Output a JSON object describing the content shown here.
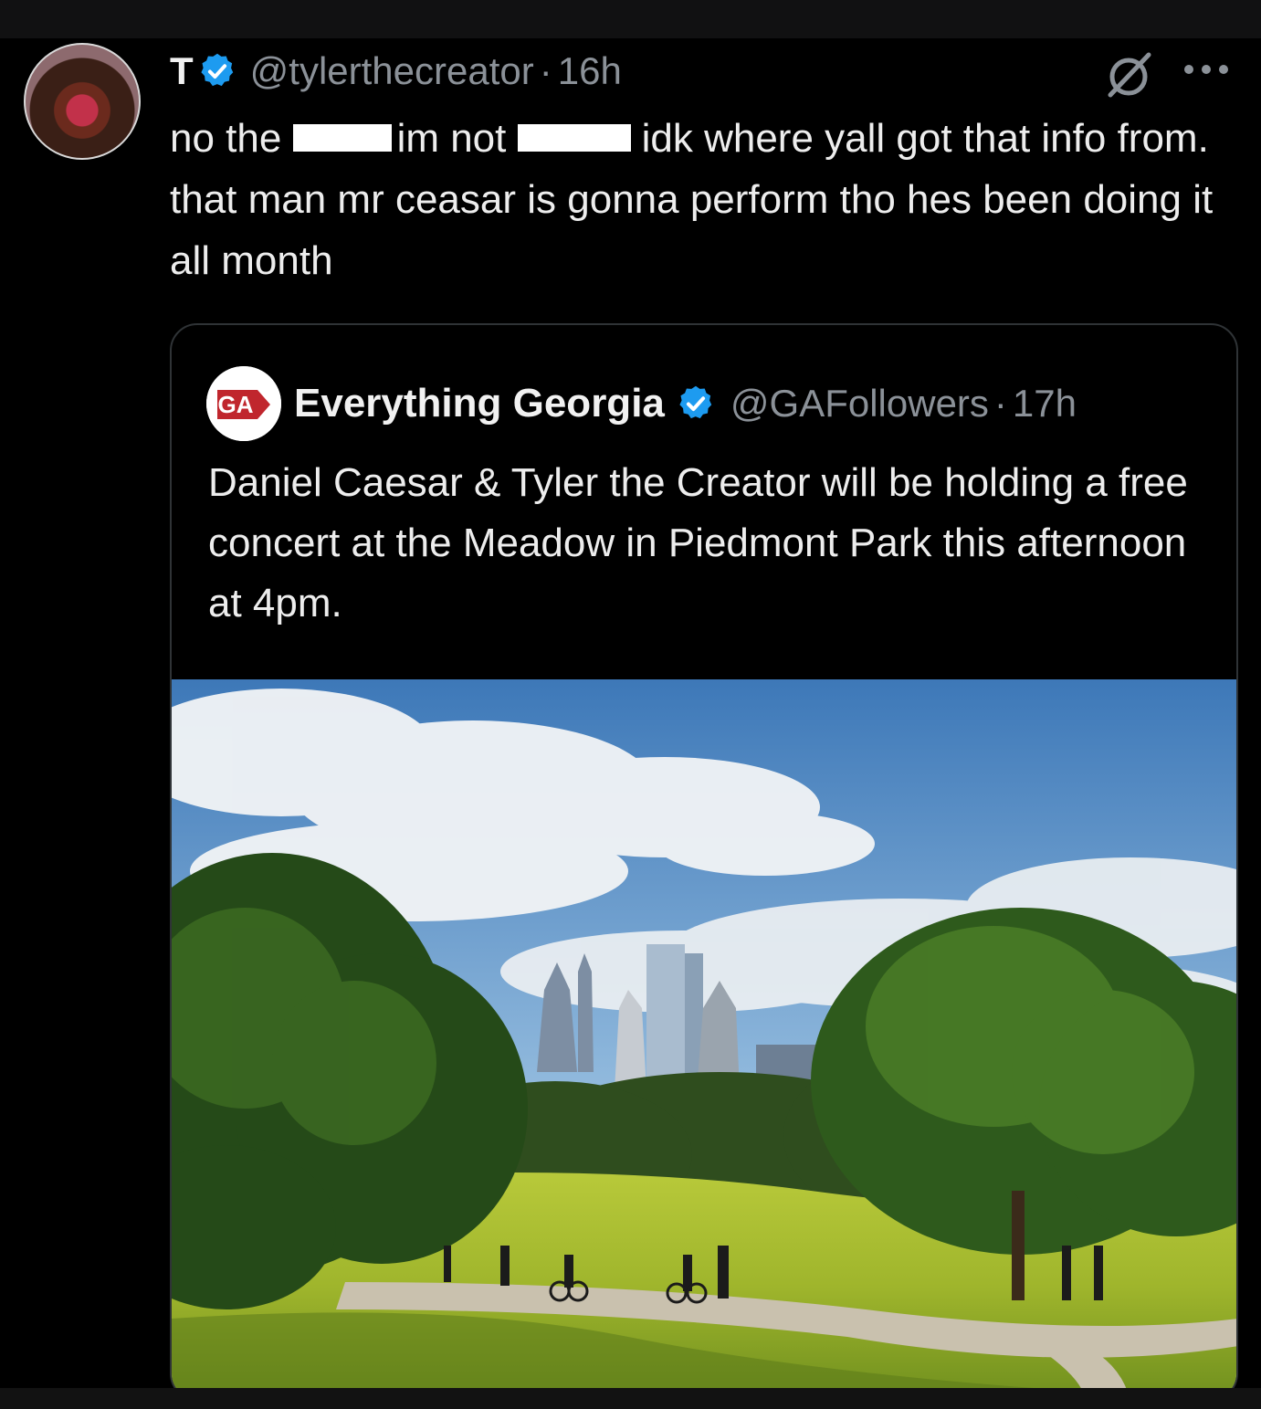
{
  "tweet": {
    "author_name": "T",
    "author_handle": "@tylerthecreator",
    "separator": "·",
    "time": "16h",
    "text_parts": [
      "no the ",
      "im not ",
      "idk where yall got that info from. that man mr ceasar is gonna perform tho hes been doing it all month"
    ],
    "icons": {
      "verified": "verified-badge-icon",
      "grok": "grok-icon",
      "more": "more-options-icon"
    }
  },
  "quoted_tweet": {
    "author_name": "Everything Georgia",
    "author_handle": "@GAFollowers",
    "separator": "·",
    "time": "17h",
    "text": "Daniel Caesar & Tyler the Creator will be holding a free concert at the Meadow in Piedmont Park this afternoon at 4pm.",
    "avatar_logo_text": "GA",
    "media": "photo of Piedmont Park meadow with Atlanta skyline"
  },
  "colors": {
    "background": "#000000",
    "verified_blue": "#1d9bf0",
    "secondary_text": "#8b9198",
    "primary_text": "#ededed",
    "border": "#2f3336"
  }
}
